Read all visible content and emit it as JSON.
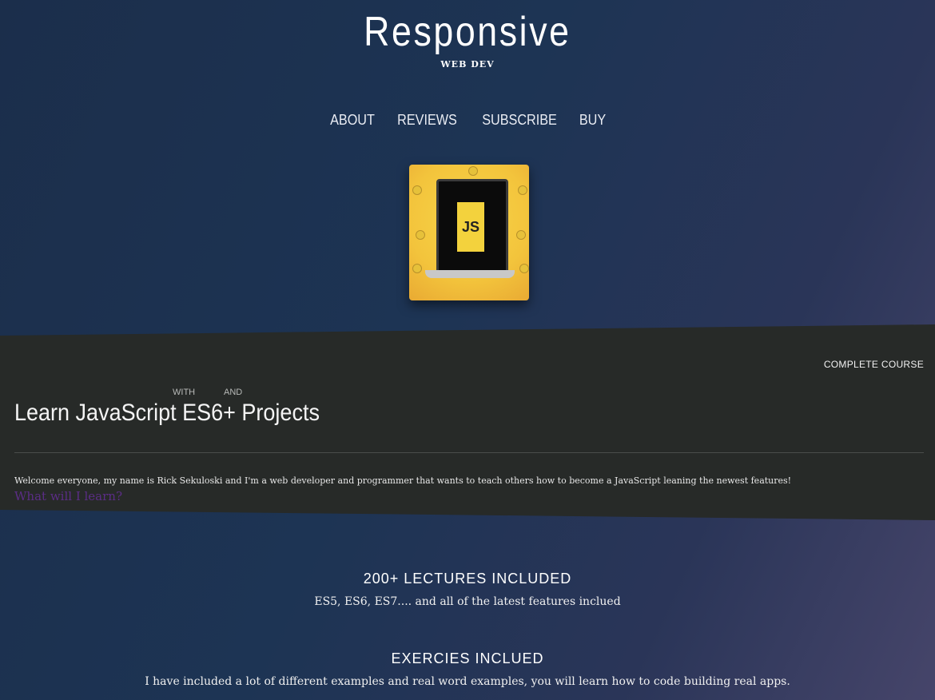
{
  "brand": {
    "title": "Responsive",
    "subtitle": "WEB DEV"
  },
  "nav": {
    "items": [
      "ABOUT",
      "REVIEWS",
      "SUBSCRIBE",
      "BUY"
    ]
  },
  "course": {
    "badge": "COMPLETE COURSE",
    "tag_with": "WITH",
    "tag_and": "AND",
    "title": "Learn JavaScript ES6+ Projects",
    "welcome": "Welcome everyone, my name is Rick Sekuloski and I'm a web developer and programmer that wants to teach others how to become a JavaScript leaning the newest features!",
    "learn_link": "What will I learn?"
  },
  "features": [
    {
      "title": "200+ LECTURES INCLUDED",
      "text": "ES5, ES6, ES7.... and all of the latest features inclued"
    },
    {
      "title": "EXERCIES INCLUED",
      "text": "I have included a lot of different examples and real word examples, you will learn how to code building real apps."
    }
  ],
  "logo": {
    "card_text": "JS"
  },
  "colors": {
    "band": "#272a28",
    "link": "#5b2d86",
    "logo_bg": "#f3c43c"
  }
}
